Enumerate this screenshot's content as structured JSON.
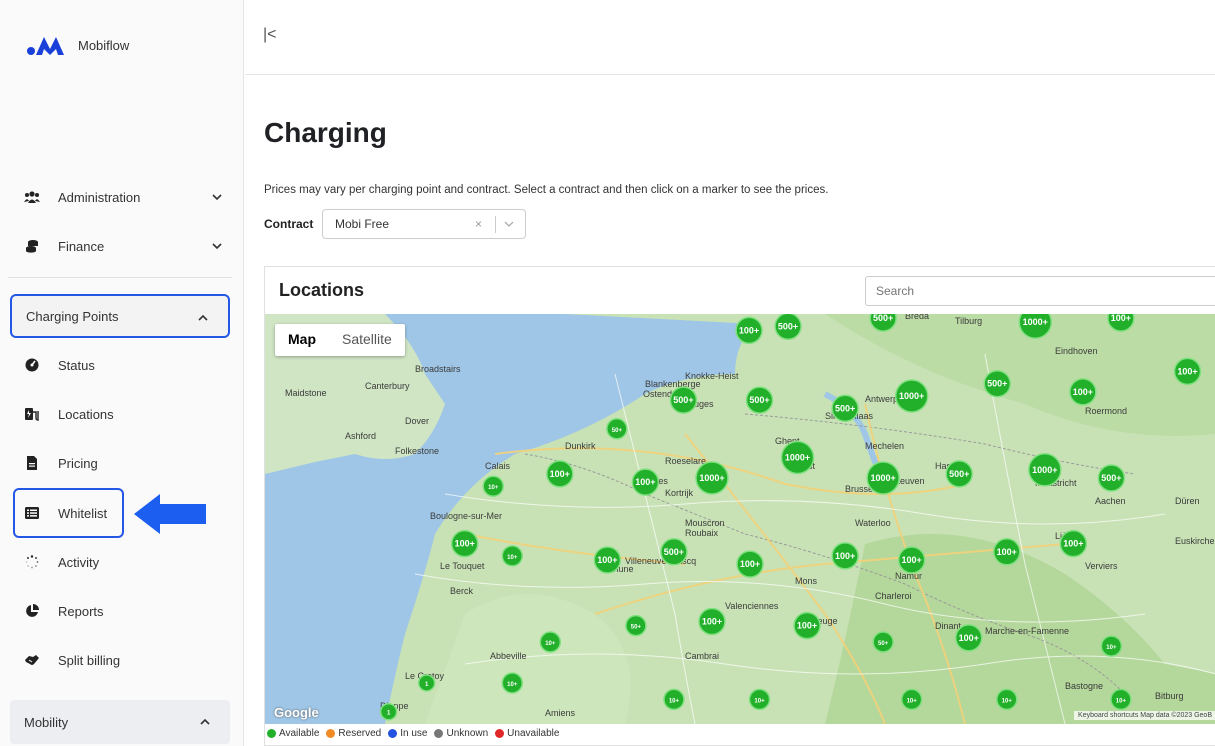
{
  "app": {
    "name": "Mobiflow",
    "brand_color": "#1b3fd9"
  },
  "sidebar": {
    "items": [
      {
        "label": "Administration",
        "icon": "users-icon"
      },
      {
        "label": "Finance",
        "icon": "coins-icon"
      }
    ],
    "charging_points": {
      "label": "Charging Points",
      "items": [
        {
          "label": "Status",
          "icon": "gauge-icon"
        },
        {
          "label": "Locations",
          "icon": "charger-icon"
        },
        {
          "label": "Pricing",
          "icon": "document-icon"
        },
        {
          "label": "Whitelist",
          "icon": "list-icon"
        },
        {
          "label": "Activity",
          "icon": "spinner-icon"
        },
        {
          "label": "Reports",
          "icon": "pie-chart-icon"
        },
        {
          "label": "Split billing",
          "icon": "handshake-icon"
        }
      ]
    },
    "mobility": {
      "label": "Mobility"
    }
  },
  "page": {
    "title": "Charging",
    "description": "Prices may vary per charging point and contract. Select a contract and then click on a marker to see the prices.",
    "contract_label": "Contract",
    "contract_value": "Mobi Free"
  },
  "locations": {
    "title": "Locations",
    "search_placeholder": "Search",
    "map_tab": "Map",
    "satellite_tab": "Satellite",
    "google": "Google",
    "attribution": "Keyboard shortcuts    Map data ©2023 GeoB",
    "cities": [
      "Breda",
      "Tilburg",
      "Eindhoven",
      "Knokke-Heist",
      "Blankenberge",
      "Ostend",
      "Bruges",
      "Antwerp",
      "Sint-Niklaas",
      "Roermond",
      "Dunkirk",
      "Ghent",
      "Mechelen",
      "Aalst",
      "Brussels",
      "Leuven",
      "Hasselt",
      "Calais",
      "Roeselare",
      "Ypres",
      "Kortrijk",
      "Maastricht",
      "Aachen",
      "Düren",
      "Boulogne-sur-Mer",
      "Mouscron",
      "Roubaix",
      "Waterloo",
      "Liège",
      "Euskirchen",
      "Broadstairs",
      "Canterbury",
      "Dover",
      "Maidstone",
      "Ashford",
      "Folkestone",
      "Le Touquet",
      "Berck",
      "Villeneuve-d'Ascq",
      "Béthune",
      "Mons",
      "Namur",
      "Charleroi",
      "Verviers",
      "Valenciennes",
      "Maubeuge",
      "Dinant",
      "Marche-en-Famenne",
      "Abbeville",
      "Le Crotoy",
      "Cambrai",
      "Amiens",
      "Dieppe",
      "Bastogne",
      "Bitburg"
    ],
    "markers": [
      {
        "label": "100+",
        "x": 0.509,
        "y": 0.04
      },
      {
        "label": "500+",
        "x": 0.55,
        "y": 0.03
      },
      {
        "label": "500+",
        "x": 0.65,
        "y": 0.01
      },
      {
        "label": "1000+",
        "x": 0.81,
        "y": 0.02
      },
      {
        "label": "100+",
        "x": 0.9,
        "y": 0.01
      },
      {
        "label": "500+",
        "x": 0.77,
        "y": 0.17
      },
      {
        "label": "100+",
        "x": 0.86,
        "y": 0.19
      },
      {
        "label": "100+",
        "x": 0.97,
        "y": 0.14
      },
      {
        "label": "500+",
        "x": 0.44,
        "y": 0.21
      },
      {
        "label": "500+",
        "x": 0.52,
        "y": 0.21
      },
      {
        "label": "500+",
        "x": 0.61,
        "y": 0.23
      },
      {
        "label": "1000+",
        "x": 0.68,
        "y": 0.2
      },
      {
        "label": "50+",
        "x": 0.37,
        "y": 0.28
      },
      {
        "label": "1000+",
        "x": 0.56,
        "y": 0.35
      },
      {
        "label": "100+",
        "x": 0.31,
        "y": 0.39
      },
      {
        "label": "100+",
        "x": 0.4,
        "y": 0.41
      },
      {
        "label": "1000+",
        "x": 0.47,
        "y": 0.4
      },
      {
        "label": "1000+",
        "x": 0.65,
        "y": 0.4
      },
      {
        "label": "500+",
        "x": 0.73,
        "y": 0.39
      },
      {
        "label": "1000+",
        "x": 0.82,
        "y": 0.38
      },
      {
        "label": "500+",
        "x": 0.89,
        "y": 0.4
      },
      {
        "label": "10+",
        "x": 0.24,
        "y": 0.42
      },
      {
        "label": "100+",
        "x": 0.21,
        "y": 0.56
      },
      {
        "label": "10+",
        "x": 0.26,
        "y": 0.59
      },
      {
        "label": "500+",
        "x": 0.43,
        "y": 0.58
      },
      {
        "label": "100+",
        "x": 0.36,
        "y": 0.6
      },
      {
        "label": "100+",
        "x": 0.51,
        "y": 0.61
      },
      {
        "label": "100+",
        "x": 0.61,
        "y": 0.59
      },
      {
        "label": "100+",
        "x": 0.68,
        "y": 0.6
      },
      {
        "label": "100+",
        "x": 0.78,
        "y": 0.58
      },
      {
        "label": "100+",
        "x": 0.85,
        "y": 0.56
      },
      {
        "label": "100+",
        "x": 0.47,
        "y": 0.75
      },
      {
        "label": "100+",
        "x": 0.57,
        "y": 0.76
      },
      {
        "label": "50+",
        "x": 0.39,
        "y": 0.76
      },
      {
        "label": "50+",
        "x": 0.65,
        "y": 0.8
      },
      {
        "label": "100+",
        "x": 0.74,
        "y": 0.79
      },
      {
        "label": "10+",
        "x": 0.89,
        "y": 0.81
      },
      {
        "label": "10+",
        "x": 0.3,
        "y": 0.8
      },
      {
        "label": "10+",
        "x": 0.26,
        "y": 0.9
      },
      {
        "label": "10+",
        "x": 0.43,
        "y": 0.94
      },
      {
        "label": "10+",
        "x": 0.52,
        "y": 0.94
      },
      {
        "label": "10+",
        "x": 0.68,
        "y": 0.94
      },
      {
        "label": "10+",
        "x": 0.78,
        "y": 0.94
      },
      {
        "label": "10+",
        "x": 0.9,
        "y": 0.94
      },
      {
        "label": "1",
        "x": 0.17,
        "y": 0.9
      },
      {
        "label": "1",
        "x": 0.13,
        "y": 0.97
      }
    ]
  },
  "legend": [
    {
      "label": "Available",
      "color": "#22b02a"
    },
    {
      "label": "Reserved",
      "color": "#f08a24"
    },
    {
      "label": "In use",
      "color": "#2452e0"
    },
    {
      "label": "Unknown",
      "color": "#777777"
    },
    {
      "label": "Unavailable",
      "color": "#e02828"
    }
  ]
}
